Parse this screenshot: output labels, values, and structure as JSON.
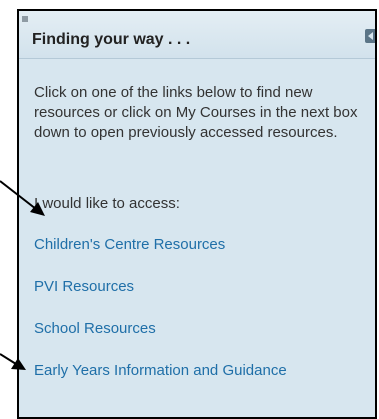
{
  "panel": {
    "title": "Finding your way . . .",
    "intro": "Click on one of the links below to find new resources or click on My Courses in the next box down to open previously accessed resources.",
    "access_label": "I would like to access:",
    "links": [
      {
        "label": "Children's Centre Resources"
      },
      {
        "label": "PVI Resources"
      },
      {
        "label": "School Resources"
      },
      {
        "label": "Early Years Information and Guidance"
      }
    ]
  },
  "colors": {
    "panel_background": "#d7e6ef",
    "link": "#1f6fa8",
    "text": "#333333",
    "arrow": "#000000"
  },
  "icons": {
    "grip": "grip-icon",
    "collapse": "collapse-icon",
    "arrows": "arrow-icon"
  }
}
